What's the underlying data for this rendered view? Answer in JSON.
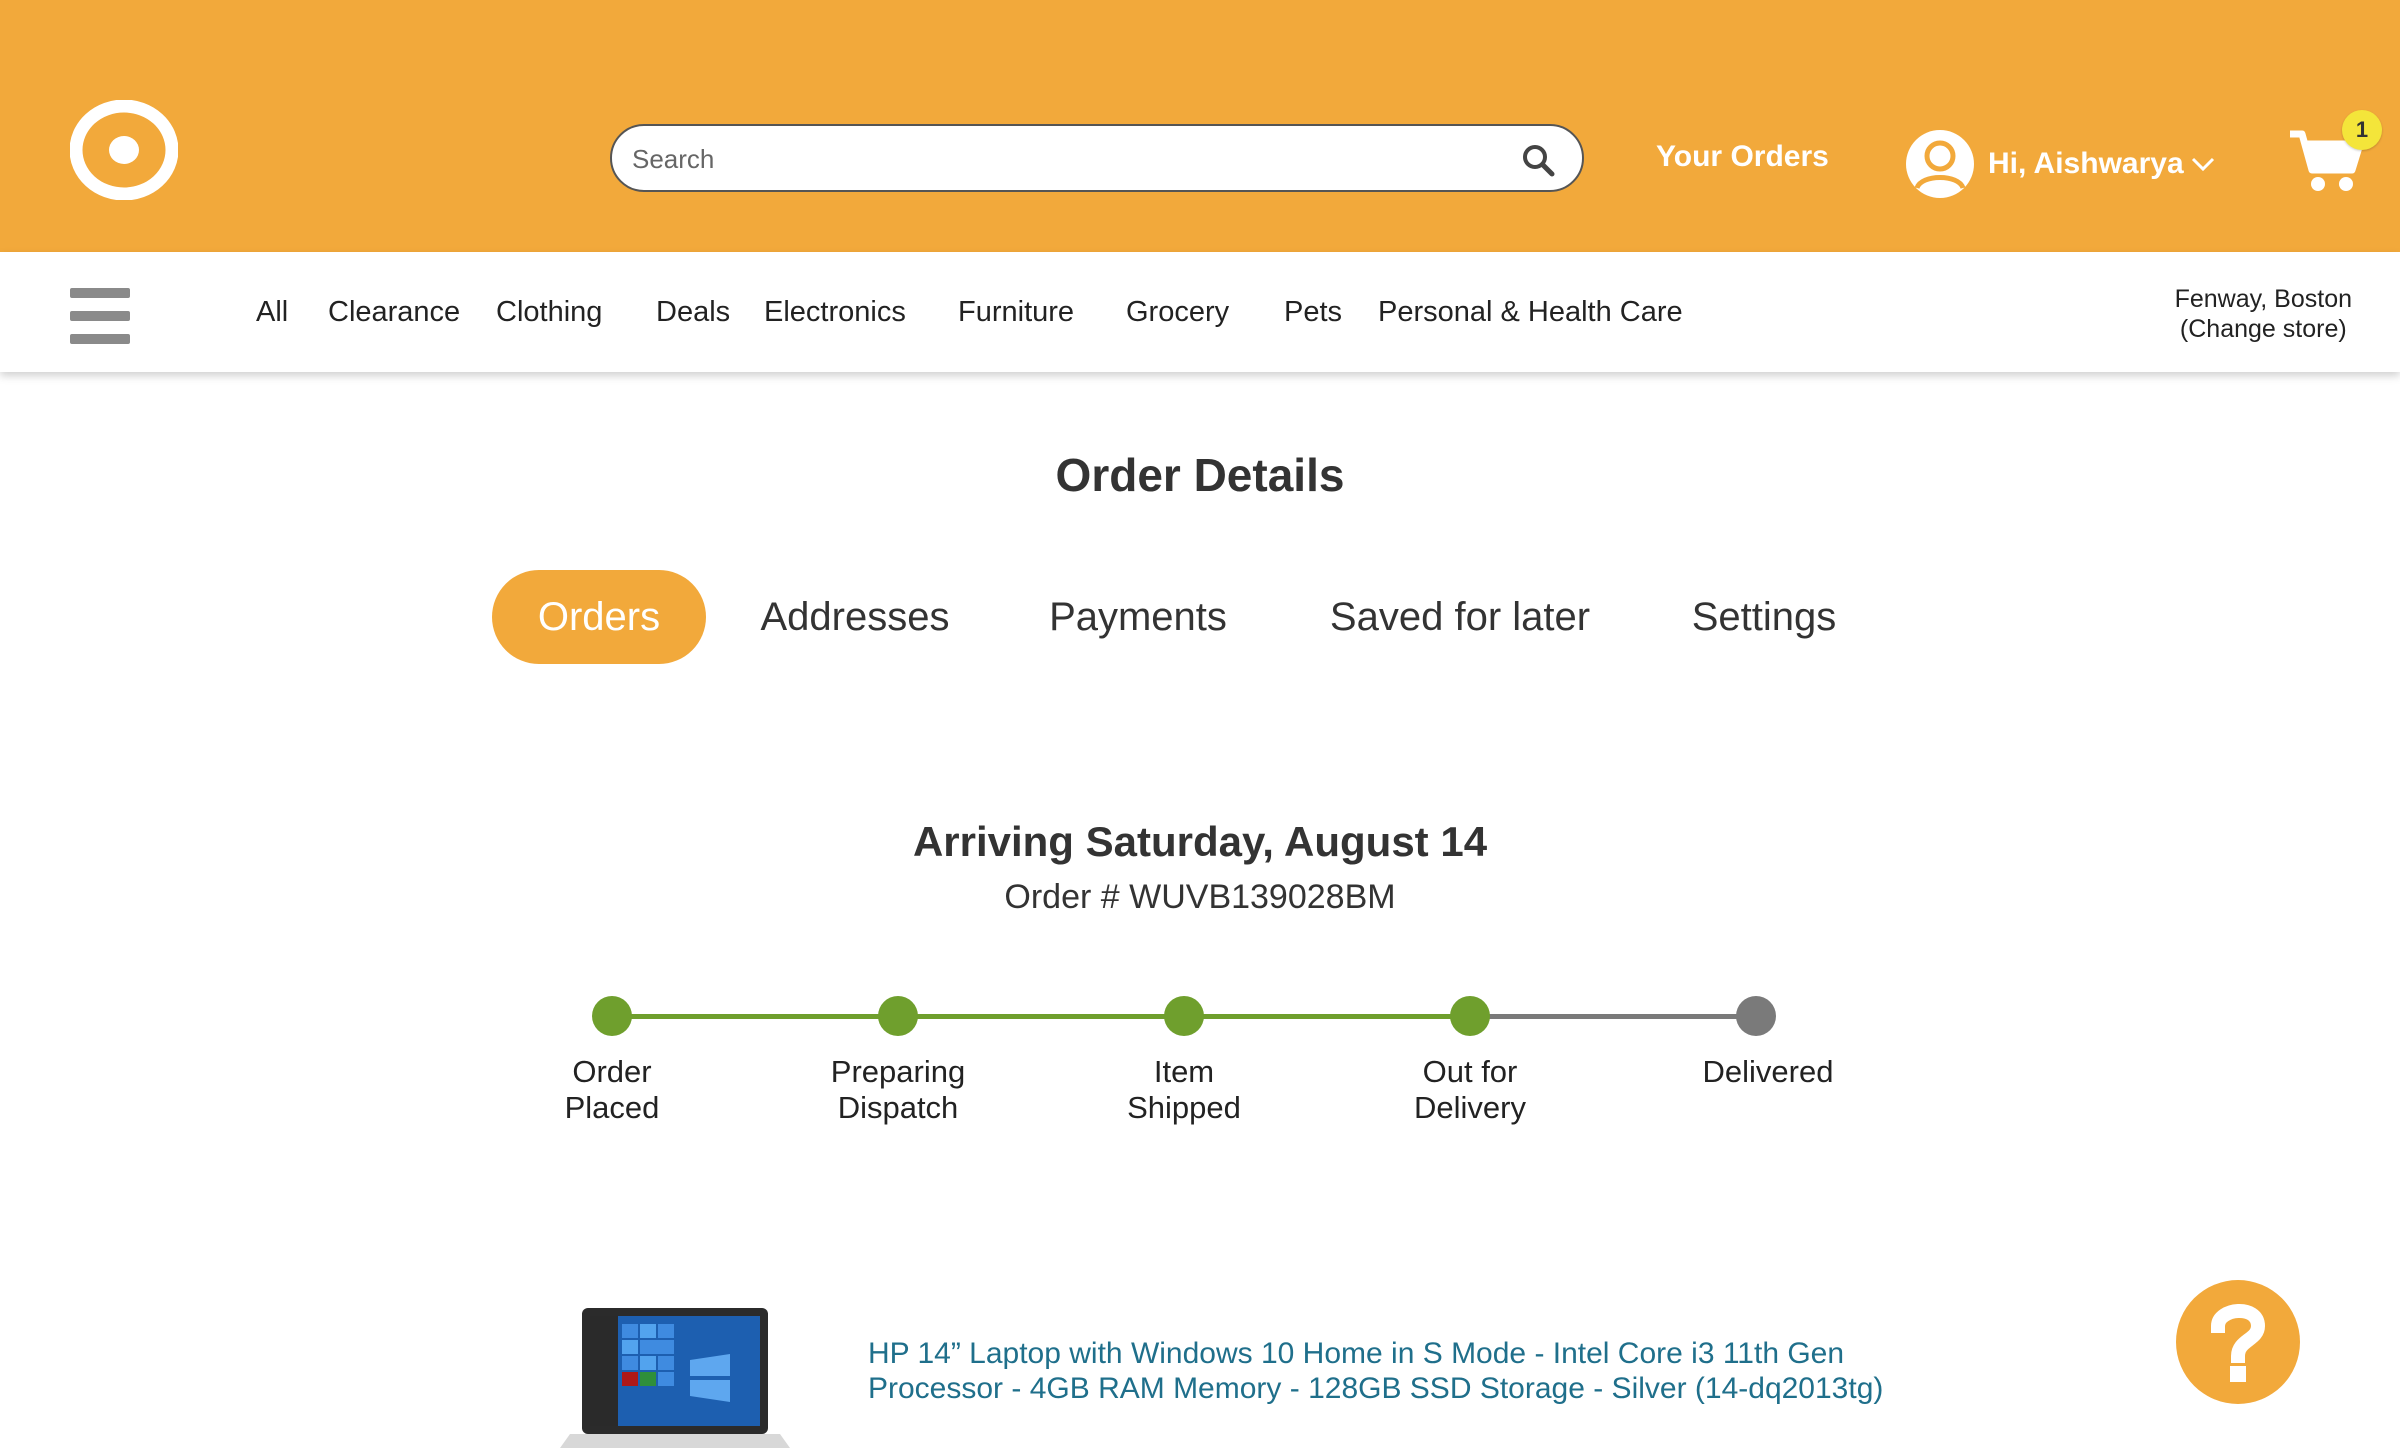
{
  "colors": {
    "brand_orange": "#f2a93b",
    "progress_green": "#6f9f2d",
    "progress_grey": "#7a7a7a",
    "link_blue": "#1f6f8b",
    "badge_yellow": "#f4e53a"
  },
  "header": {
    "logo_icon": "bullseye-logo-icon",
    "search": {
      "placeholder": "Search",
      "value": "",
      "icon": "search-icon"
    },
    "your_orders": "Your Orders",
    "account": {
      "greeting": "Hi, Aishwarya",
      "icon": "user-avatar-icon"
    },
    "cart": {
      "count": "1",
      "icon": "cart-icon"
    }
  },
  "nav": {
    "categories": [
      "All",
      "Clearance",
      "Clothing",
      "Deals",
      "Electronics",
      "Furniture",
      "Grocery",
      "Pets",
      "Personal & Health Care"
    ],
    "store": {
      "location": "Fenway, Boston",
      "change_label": "(Change store)"
    }
  },
  "main": {
    "title": "Order Details",
    "tabs": [
      {
        "label": "Orders",
        "active": true
      },
      {
        "label": "Addresses",
        "active": false
      },
      {
        "label": "Payments",
        "active": false
      },
      {
        "label": "Saved for later",
        "active": false
      },
      {
        "label": "Settings",
        "active": false
      }
    ],
    "arriving": "Arriving Saturday, August 14",
    "order_number": "Order # WUVB139028BM",
    "progress": {
      "steps": [
        {
          "label_line1": "Order",
          "label_line2": "Placed",
          "complete": true
        },
        {
          "label_line1": "Preparing",
          "label_line2": "Dispatch",
          "complete": true
        },
        {
          "label_line1": "Item",
          "label_line2": "Shipped",
          "complete": true
        },
        {
          "label_line1": "Out for",
          "label_line2": "Delivery",
          "complete": true
        },
        {
          "label_line1": "Delivered",
          "label_line2": "",
          "complete": false
        }
      ]
    },
    "product": {
      "title_line1": "HP 14” Laptop with Windows 10 Home in S Mode - Intel Core i3 11th Gen",
      "title_line2": "Processor - 4GB RAM Memory - 128GB SSD Storage - Silver (14-dq2013tg)",
      "image_icon": "laptop-image"
    },
    "help_icon": "question-mark-icon"
  }
}
